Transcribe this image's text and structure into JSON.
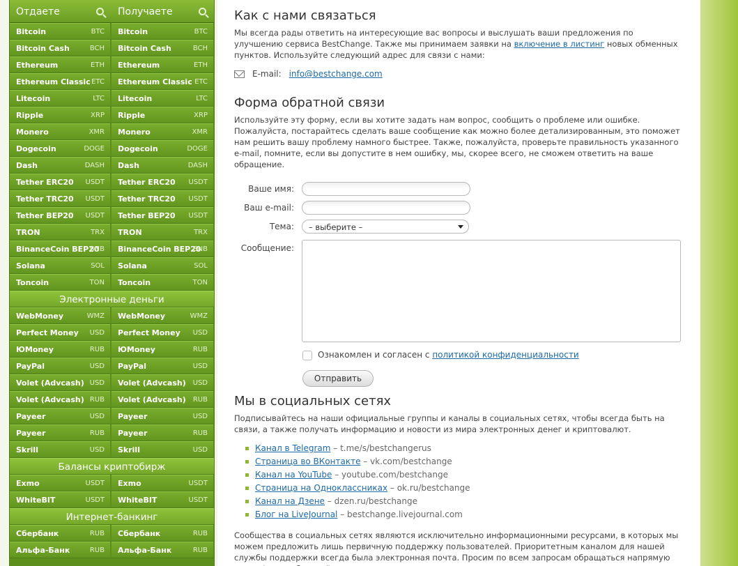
{
  "left": {
    "give_label": "Отдаете",
    "get_label": "Получаете",
    "groups": [
      {
        "title": "",
        "items": [
          {
            "name": "Bitcoin",
            "code": "BTC"
          },
          {
            "name": "Bitcoin Cash",
            "code": "BCH"
          },
          {
            "name": "Ethereum",
            "code": "ETH"
          },
          {
            "name": "Ethereum Classic",
            "code": "ETC"
          },
          {
            "name": "Litecoin",
            "code": "LTC"
          },
          {
            "name": "Ripple",
            "code": "XRP"
          },
          {
            "name": "Monero",
            "code": "XMR"
          },
          {
            "name": "Dogecoin",
            "code": "DOGE"
          },
          {
            "name": "Dash",
            "code": "DASH"
          },
          {
            "name": "Tether ERC20",
            "code": "USDT"
          },
          {
            "name": "Tether TRC20",
            "code": "USDT"
          },
          {
            "name": "Tether BEP20",
            "code": "USDT"
          },
          {
            "name": "TRON",
            "code": "TRX"
          },
          {
            "name": "BinanceCoin BEP20",
            "code": "BNB"
          },
          {
            "name": "Solana",
            "code": "SOL"
          },
          {
            "name": "Toncoin",
            "code": "TON"
          }
        ]
      },
      {
        "title": "Электронные деньги",
        "items": [
          {
            "name": "WebMoney",
            "code": "WMZ"
          },
          {
            "name": "Perfect Money",
            "code": "USD"
          },
          {
            "name": "ЮMoney",
            "code": "RUB"
          },
          {
            "name": "PayPal",
            "code": "USD"
          },
          {
            "name": "Volet (Advcash)",
            "code": "USD"
          },
          {
            "name": "Volet (Advcash)",
            "code": "RUB"
          },
          {
            "name": "Payeer",
            "code": "USD"
          },
          {
            "name": "Payeer",
            "code": "RUB"
          },
          {
            "name": "Skrill",
            "code": "USD"
          }
        ]
      },
      {
        "title": "Балансы криптобирж",
        "items": [
          {
            "name": "Exmo",
            "code": "USDT"
          },
          {
            "name": "WhiteBIT",
            "code": "USDT"
          }
        ]
      },
      {
        "title": "Интернет-банкинг",
        "items": [
          {
            "name": "Сбербанк",
            "code": "RUB"
          },
          {
            "name": "Альфа-Банк",
            "code": "RUB"
          }
        ]
      }
    ]
  },
  "contact": {
    "title": "Как с нами связаться",
    "intro_before": "Мы всегда рады ответить на интересующие вас вопросы и выслушать ваши предложения по улучшению сервиса BestChange. Также мы принимаем заявки на ",
    "intro_link": "включение в листинг",
    "intro_after": " новых обменных пунктов. Используйте следующий адрес для связи с нами:",
    "email_label": "E-mail:",
    "email": "info@bestchange.com"
  },
  "feedback": {
    "title": "Форма обратной связи",
    "text": "Используйте эту форму, если вы хотите задать нам вопрос, сообщить о проблеме или ошибке. Пожалуйста, постарайтесь сделать ваше сообщение как можно более детализированным, это поможет нам решить вашу проблему намного быстрее. Также, пожалуйста, проверьте правильность указанного e-mail, помните, если вы допустите в нем ошибку, мы, скорее всего, не сможем ответить на ваше обращение.",
    "name_label": "Ваше имя:",
    "name_value": "",
    "email_label": "Ваш e-mail:",
    "email_value": "",
    "topic_label": "Тема:",
    "topic_value": "– выберите –",
    "message_label": "Сообщение:",
    "message_value": "",
    "consent_before": "Ознакомлен и согласен с ",
    "consent_link": "политикой конфиденциальности",
    "consent_checked": false,
    "submit_label": "Отправить"
  },
  "social": {
    "title": "Мы в социальных сетях",
    "text": "Подписывайтесь на наши официальные группы и каналы в социальных сетях, чтобы всегда быть на связи, а также получать информацию и новости из мира электронных денег и криптовалют.",
    "links": [
      {
        "label": "Канал в Telegram",
        "url": "t.me/s/bestchangerus"
      },
      {
        "label": "Страница во ВКонтакте",
        "url": "vk.com/bestchange"
      },
      {
        "label": "Канал на YouTube",
        "url": "youtube.com/bestchange"
      },
      {
        "label": "Страница на Одноклассниках",
        "url": "ok.ru/bestchange"
      },
      {
        "label": "Канал на Дзене",
        "url": "dzen.ru/bestchange"
      },
      {
        "label": "Блог на LiveJournal",
        "url": "bestchange.livejournal.com"
      }
    ],
    "outro": "Сообщества в социальных сетях являются исключительно информационными ресурсами, в которых мы можем предложить лишь первичную поддержку пользователей. Приоритетным каналом для нашей службы поддержки всегда была электронная почта. Просим по всем запросам обращаться напрямую через форму обратной связи."
  }
}
